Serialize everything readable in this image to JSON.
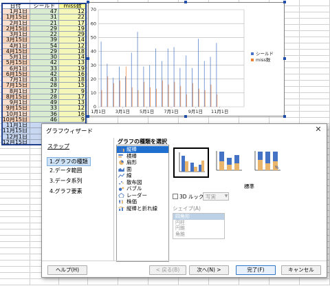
{
  "spreadsheet": {
    "headers": [
      "日付",
      "シールド",
      "miss数"
    ],
    "rows": [
      [
        "1月1日",
        47,
        12
      ],
      [
        "1月15日",
        31,
        22
      ],
      [
        "2月1日",
        21,
        17
      ],
      [
        "2月15日",
        29,
        19
      ],
      [
        "3月1日",
        22,
        29
      ],
      [
        "3月15日",
        39,
        14
      ],
      [
        "4月1日",
        54,
        12
      ],
      [
        "4月15日",
        29,
        18
      ],
      [
        "5月1日",
        30,
        14
      ],
      [
        "5月15日",
        42,
        13
      ],
      [
        "6月1日",
        33,
        19
      ],
      [
        "6月15日",
        42,
        16
      ],
      [
        "7月1日",
        43,
        18
      ],
      [
        "7月15日",
        28,
        15
      ],
      [
        "8月1日",
        37,
        9
      ],
      [
        "8月15日",
        28,
        17
      ],
      [
        "9月1日",
        49,
        13
      ],
      [
        "9月15日",
        33,
        12
      ],
      [
        "10月1日",
        36,
        16
      ],
      [
        "10月15日",
        46,
        9
      ],
      [
        "11月1日",
        "",
        ""
      ],
      [
        "11月15日",
        "",
        ""
      ],
      [
        "12月1日",
        "",
        ""
      ],
      [
        "12月15日",
        "",
        ""
      ]
    ]
  },
  "chart_data": {
    "type": "bar",
    "categories": [
      "1月1日",
      "1月15日",
      "2月1日",
      "2月15日",
      "3月1日",
      "3月15日",
      "4月1日",
      "4月15日",
      "5月1日",
      "5月15日",
      "6月1日",
      "6月15日",
      "7月1日",
      "7月15日",
      "8月1日",
      "8月15日",
      "9月1日",
      "9月15日",
      "10月1日",
      "10月15日",
      "11月1日",
      "11月15日",
      "12月1日",
      "12月15日"
    ],
    "tick_labels": [
      "1月1日",
      "3月1日",
      "5月1日",
      "7月1日",
      "9月1日",
      "11月1日"
    ],
    "series": [
      {
        "name": "シールド",
        "color": "#4472c4",
        "values": [
          47,
          31,
          21,
          29,
          22,
          39,
          54,
          29,
          30,
          42,
          33,
          42,
          43,
          28,
          37,
          28,
          49,
          33,
          36,
          46,
          null,
          null,
          null,
          null
        ]
      },
      {
        "name": "miss数",
        "color": "#ed7d31",
        "values": [
          12,
          22,
          17,
          19,
          29,
          14,
          12,
          18,
          14,
          13,
          19,
          16,
          18,
          15,
          9,
          17,
          13,
          12,
          16,
          9,
          null,
          null,
          null,
          null
        ]
      }
    ],
    "ylim": [
      0,
      70
    ],
    "yticks": [
      0,
      10,
      20,
      30,
      40,
      50,
      60,
      70
    ],
    "legend_position": "right",
    "grid": true
  },
  "dialog": {
    "title": "グラフウィザード",
    "steps_heading": "ステップ",
    "steps": [
      "1.グラフの種類",
      "2.データ範囲",
      "3.データ系列",
      "4.グラフ要素"
    ],
    "active_step": 0,
    "type_heading": "グラフの種類を選択",
    "chart_types": [
      {
        "label": "縦棒",
        "icon": "column-chart-icon"
      },
      {
        "label": "横棒",
        "icon": "bar-chart-icon"
      },
      {
        "label": "扇形",
        "icon": "pie-chart-icon"
      },
      {
        "label": "面",
        "icon": "area-chart-icon"
      },
      {
        "label": "線",
        "icon": "line-chart-icon"
      },
      {
        "label": "散布図",
        "icon": "scatter-chart-icon"
      },
      {
        "label": "バブル",
        "icon": "bubble-chart-icon"
      },
      {
        "label": "レーダー",
        "icon": "radar-chart-icon"
      },
      {
        "label": "株価",
        "icon": "stock-chart-icon"
      },
      {
        "label": "縦棒と折れ線",
        "icon": "column-line-chart-icon"
      }
    ],
    "selected_type": 0,
    "variant_label": "標準",
    "three_d": {
      "label": "3D ルック",
      "checked": false,
      "select_value": "写実"
    },
    "shape_label": "シェイプ(A)",
    "shapes": [
      "四角形",
      "円柱",
      "円錐",
      "角錐"
    ],
    "buttons": {
      "help": "ヘルプ(H)",
      "back": "< 戻る(B)",
      "next": "次へ(N) >",
      "finish": "完了(F)",
      "cancel": "キャンセル"
    },
    "colors": {
      "accent": "#1f6fd0",
      "series1": "#4472c4",
      "series2": "#ed7d31"
    }
  }
}
